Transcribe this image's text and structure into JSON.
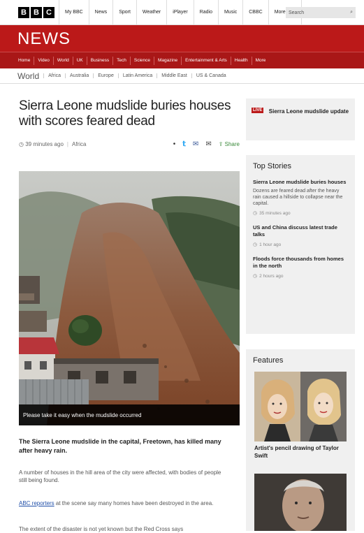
{
  "bbc_bar": {
    "logo": [
      "B",
      "B",
      "C"
    ],
    "nav": [
      "My BBC",
      "News",
      "Sport",
      "Weather",
      "iPlayer",
      "Radio",
      "Music",
      "CBBC",
      "More"
    ],
    "search_placeholder": "Search"
  },
  "news": {
    "title": "NEWS",
    "nav": [
      "Home",
      "Video",
      "World",
      "UK",
      "Business",
      "Tech",
      "Science",
      "Magazine",
      "Entertainment & Arts",
      "Health",
      "More"
    ]
  },
  "sub_nav": {
    "section": "World",
    "items": [
      "Africa",
      "Australia",
      "Europe",
      "Latin America",
      "Middle East",
      "US & Canada"
    ]
  },
  "article": {
    "headline": "Sierra Leone mudslide buries houses with scores feared dead",
    "time": "39 minutes ago",
    "section": "Africa",
    "share_label": "Share",
    "caption": "Please take it easy when the mudslide occurred",
    "lead": "The Sierra Leone mudslide in the capital, Freetown, has killed many after heavy rain.",
    "para1": "A number of houses in the hill area of the city were affected, with bodies of people still being found.",
    "para2_link": "ABC reporters",
    "para2": " at the scene say many homes have been destroyed in the area.",
    "para3": "The extent of the disaster is not yet known but the Red Cross says"
  },
  "breaking": {
    "badge": "LIVE",
    "text": "Sierra Leone mudslide update"
  },
  "top_stories": {
    "title": "Top Stories",
    "items": [
      {
        "headline": "Sierra Leone mudslide buries houses",
        "desc": "Dozens are feared dead after the heavy rain caused a hillside to collapse near the capital.",
        "time": "35 minutes ago"
      },
      {
        "headline": "US and China discuss latest trade talks",
        "desc": "",
        "time": "1 hour ago"
      },
      {
        "headline": "Floods force thousands from homes in the north",
        "desc": "",
        "time": "2 hours ago"
      }
    ]
  },
  "features": {
    "title": "Features",
    "caption": "Artist's pencil drawing of Taylor Swift"
  },
  "colors": {
    "brand_red": "#bb1919",
    "link_blue": "#1f4ea8"
  }
}
